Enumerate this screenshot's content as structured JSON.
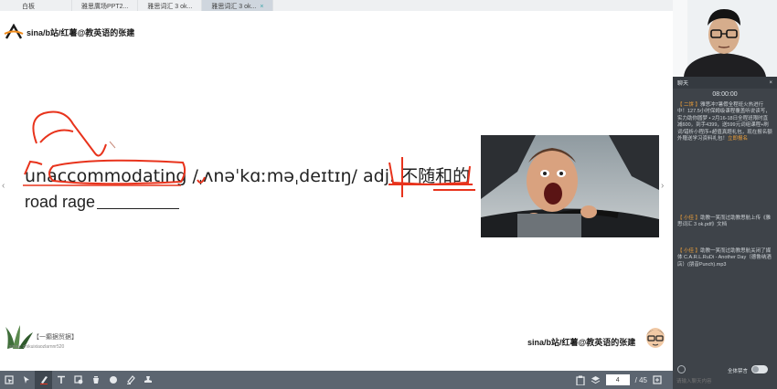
{
  "tabs": [
    {
      "label": "白板",
      "active": false
    },
    {
      "label": "雅思廣场PPT2...",
      "active": false
    },
    {
      "label": "雅思词汇 3 ok...",
      "active": false
    },
    {
      "label": "雅思词汇 3 ok...",
      "active": true,
      "close": "×"
    }
  ],
  "slide": {
    "brand_top": "sina/b站/红薯@教英语的张建",
    "word": "unaccommodating",
    "phonetic": "/ˌʌnəˈkɑːməˌdeɪtɪŋ/",
    "pos": "adj.",
    "meaning": "不随和的",
    "phrase": "road rage",
    "nav_prev": "‹",
    "nav_next": "›",
    "corner_text": "【一癫据贸据】",
    "corner_sub": "sinaa: zhikuixiaozlarnnr520",
    "brand_bottom": "sina/b站/红薯@教英语的张建"
  },
  "toolbar": {
    "tools": [
      "select-icon",
      "pointer-icon",
      "pen-icon",
      "text-icon",
      "erase-object-icon",
      "delete-icon",
      "palette-icon",
      "highlighter-icon",
      "stamp-icon"
    ],
    "page_current": "4",
    "page_total": "/ 45"
  },
  "chat": {
    "title": "聊天",
    "close": "×",
    "time": "08:00:00",
    "messages": [
      {
        "tag": "【 二饼 】",
        "text": "雅思冲7暑假全程班火热进行中！127.5小时保姆级课程覆盖听说读写，实力助你圆梦 • 2月16-18日全程班限时直减600，到手4399，送599元词组课程+刷词/错析小程序+超值真题礼包，现在报名额外赠送学习资料礼包！",
        "highlight": "立即报名"
      },
      {
        "tag": "【 小佳 】",
        "text": "助教一笑而过助教思航上传《雅思词汇 3 ok.pdf》文档"
      },
      {
        "tag": "【 小佳 】",
        "text": "助教一笑而过助教思航关闭了媒体 C.A.R.L.RuDi - Another Day（德鲁纳酒店）(朋音Punch).mp3"
      }
    ],
    "mute_label": "全体禁言",
    "input_placeholder": "请输入聊天内容"
  },
  "colors": {
    "ink": "#e8331c",
    "toolbar": "#5c6570",
    "chat_bg": "#3e4349",
    "accent": "#f0a13a"
  }
}
